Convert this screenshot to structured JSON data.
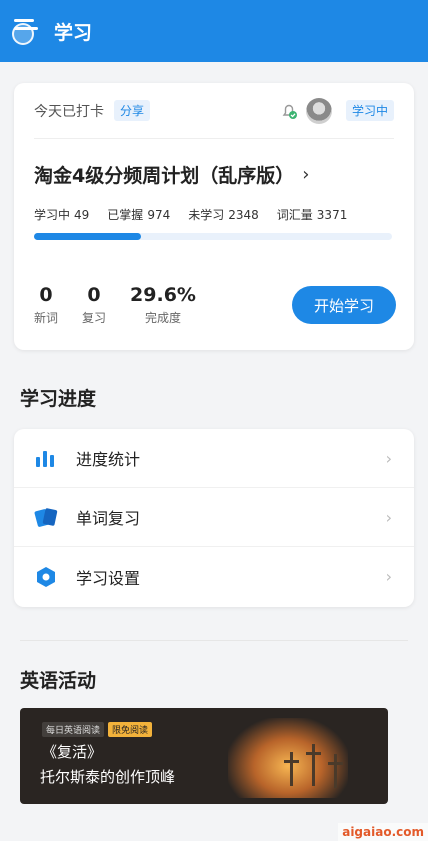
{
  "header": {
    "title": "学习"
  },
  "plan_card": {
    "checkin_text": "今天已打卡",
    "share_label": "分享",
    "status_label": "学习中",
    "plan_title": "淘金4级分频周计划（乱序版）",
    "stats": {
      "learning_label": "学习中",
      "learning_value": "49",
      "mastered_label": "已掌握",
      "mastered_value": "974",
      "unlearned_label": "未学习",
      "unlearned_value": "2348",
      "vocab_label": "词汇量",
      "vocab_value": "3371"
    },
    "progress_fraction": 0.3,
    "counts": [
      {
        "num": "0",
        "label": "新词"
      },
      {
        "num": "0",
        "label": "复习"
      },
      {
        "num": "29.6%",
        "label": "完成度"
      }
    ],
    "start_button": "开始学习"
  },
  "progress_section": {
    "title": "学习进度",
    "items": [
      {
        "label": "进度统计",
        "icon": "bar-chart-icon"
      },
      {
        "label": "单词复习",
        "icon": "cards-icon"
      },
      {
        "label": "学习设置",
        "icon": "settings-hex-icon"
      }
    ]
  },
  "activity_section": {
    "title": "英语活动",
    "banner": {
      "tag1": "每日英语阅读",
      "tag2": "限免阅读",
      "line1": "《复活》",
      "line2": "托尔斯泰的创作顶峰"
    }
  },
  "watermark": "aigaiao.com",
  "colors": {
    "accent": "#1e88e5"
  }
}
